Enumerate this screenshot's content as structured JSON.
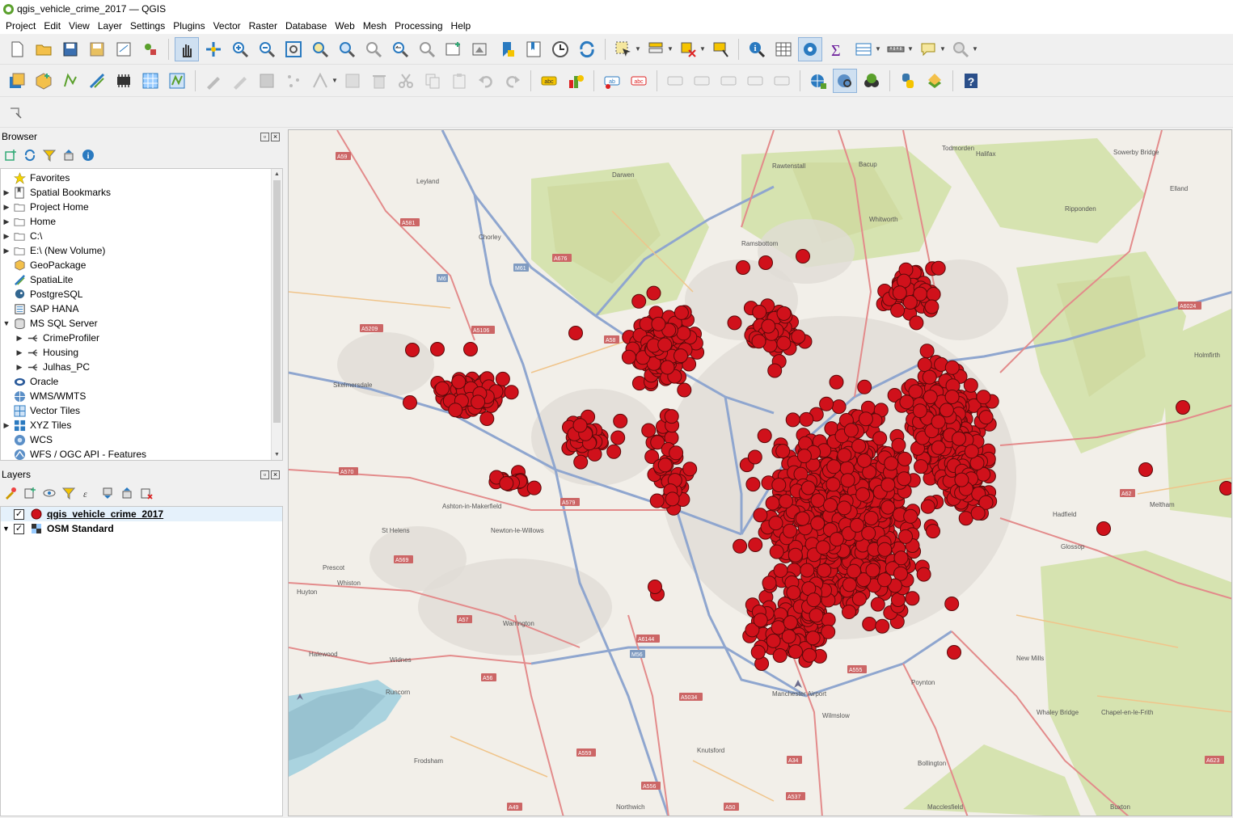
{
  "window": {
    "title": "qgis_vehicle_crime_2017 — QGIS"
  },
  "menu": [
    "Project",
    "Edit",
    "View",
    "Layer",
    "Settings",
    "Plugins",
    "Vector",
    "Raster",
    "Database",
    "Web",
    "Mesh",
    "Processing",
    "Help"
  ],
  "browser": {
    "title": "Browser",
    "items": [
      {
        "label": "Favorites",
        "icon": "star-icon",
        "expand": ""
      },
      {
        "label": "Spatial Bookmarks",
        "icon": "bookmark-icon",
        "expand": "▶"
      },
      {
        "label": "Project Home",
        "icon": "folder-icon",
        "expand": "▶"
      },
      {
        "label": "Home",
        "icon": "folder-icon",
        "expand": "▶"
      },
      {
        "label": "C:\\",
        "icon": "folder-icon",
        "expand": "▶"
      },
      {
        "label": "E:\\ (New Volume)",
        "icon": "folder-icon",
        "expand": "▶"
      },
      {
        "label": "GeoPackage",
        "icon": "geopackage-icon",
        "expand": ""
      },
      {
        "label": "SpatiaLite",
        "icon": "spatialite-icon",
        "expand": ""
      },
      {
        "label": "PostgreSQL",
        "icon": "postgresql-icon",
        "expand": ""
      },
      {
        "label": "SAP HANA",
        "icon": "sap-hana-icon",
        "expand": ""
      },
      {
        "label": "MS SQL Server",
        "icon": "mssql-icon",
        "expand": "▼"
      },
      {
        "label": "CrimeProfiler",
        "icon": "connection-icon",
        "expand": "▶",
        "sub": true
      },
      {
        "label": "Housing",
        "icon": "connection-icon",
        "expand": "▶",
        "sub": true
      },
      {
        "label": "Julhas_PC",
        "icon": "connection-icon",
        "expand": "▶",
        "sub": true
      },
      {
        "label": "Oracle",
        "icon": "oracle-icon",
        "expand": ""
      },
      {
        "label": "WMS/WMTS",
        "icon": "wms-icon",
        "expand": ""
      },
      {
        "label": "Vector Tiles",
        "icon": "vector-tiles-icon",
        "expand": ""
      },
      {
        "label": "XYZ Tiles",
        "icon": "xyz-tiles-icon",
        "expand": "▶"
      },
      {
        "label": "WCS",
        "icon": "wcs-icon",
        "expand": ""
      },
      {
        "label": "WFS / OGC API - Features",
        "icon": "wfs-icon",
        "expand": ""
      }
    ]
  },
  "layers": {
    "title": "Layers",
    "items": [
      {
        "name": "qgis_vehicle_crime_2017",
        "checked": "✓",
        "expand": ""
      },
      {
        "name": "OSM Standard",
        "checked": "✓",
        "expand": "▼"
      }
    ]
  },
  "map": {
    "point_color": "#d0111b",
    "labels": [
      "Darwen",
      "Leyland",
      "Chorley",
      "Rawtenstall",
      "Bacup",
      "Todmorden",
      "Halifax",
      "Sowerby Bridge",
      "Elland",
      "Ripponden",
      "Whitworth",
      "Ramsbottom",
      "Skelmersdale",
      "St Helens",
      "Ashton-in-Makerfield",
      "Newton-le-Willows",
      "Prescot",
      "Whiston",
      "Huyton",
      "Halewood",
      "Widnes",
      "Warrington",
      "Runcorn",
      "Frodsham",
      "Knutsford",
      "Wilmslow",
      "Macclesfield",
      "Bollington",
      "Poynton",
      "New Mills",
      "Whaley Bridge",
      "Chapel-en-le-Frith",
      "Glossop",
      "Hadfield",
      "Meltham",
      "Holmfirth",
      "Northwich",
      "Buxton",
      "Manchester Airport"
    ],
    "roads": [
      "A59",
      "A581",
      "M6",
      "M61",
      "A676",
      "A5209",
      "A5106",
      "A58",
      "A570",
      "A579",
      "A569",
      "A57",
      "M56",
      "A6144",
      "A56",
      "A5034",
      "A559",
      "A556",
      "A49",
      "A50",
      "A537",
      "A34",
      "A555",
      "A6024",
      "A623",
      "A62"
    ]
  }
}
